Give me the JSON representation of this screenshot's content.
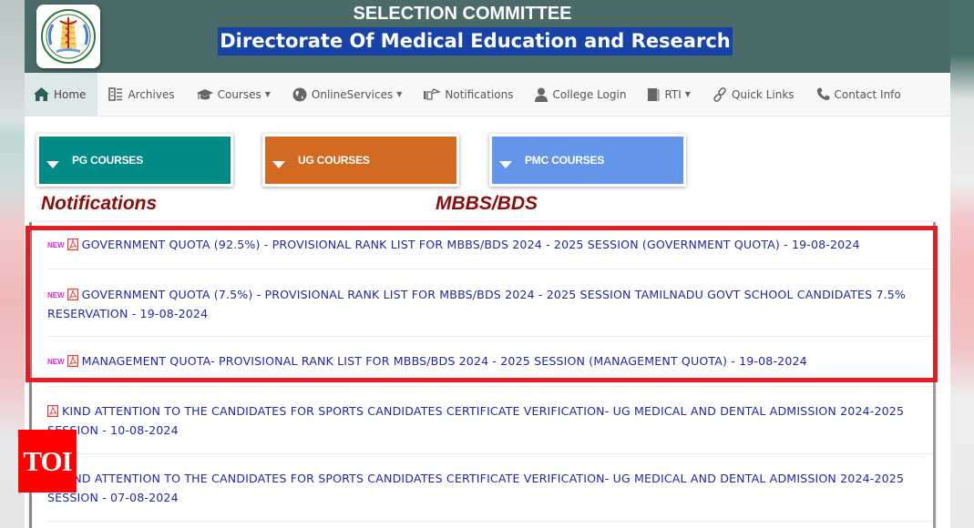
{
  "header": {
    "org_title": "SELECTION COMMITTEE",
    "main_title": "Directorate Of Medical Education and Research",
    "colors": {
      "header_bg": "#4a6b69",
      "title_highlight": "#1743a9"
    }
  },
  "nav": {
    "items": [
      {
        "label": "Home",
        "icon": "home-icon",
        "active": true,
        "dropdown": false
      },
      {
        "label": "Archives",
        "icon": "archive-icon",
        "active": false,
        "dropdown": false
      },
      {
        "label": "Courses",
        "icon": "graduation-cap-icon",
        "active": false,
        "dropdown": true
      },
      {
        "label": "OnlineServices",
        "icon": "globe-icon",
        "active": false,
        "dropdown": true
      },
      {
        "label": "Notifications",
        "icon": "hand-pointer-icon",
        "active": false,
        "dropdown": false
      },
      {
        "label": "College Login",
        "icon": "user-icon",
        "active": false,
        "dropdown": false
      },
      {
        "label": "RTI",
        "icon": "book-icon",
        "active": false,
        "dropdown": true
      },
      {
        "label": "Quick Links",
        "icon": "link-icon",
        "active": false,
        "dropdown": false
      },
      {
        "label": "Contact Info",
        "icon": "phone-icon",
        "active": false,
        "dropdown": false
      }
    ],
    "caret": "▼"
  },
  "courses": [
    {
      "label": "PG COURSES",
      "color": "#008b87"
    },
    {
      "label": "UG COURSES",
      "color": "#d36a22"
    },
    {
      "label": "PMC COURSES",
      "color": "#6495e8"
    }
  ],
  "sections": {
    "left_heading": "Notifications",
    "center_heading": "MBBS/BDS"
  },
  "notifications": [
    {
      "is_new": true,
      "new_label": "NEW",
      "text": "GOVERNMENT QUOTA (92.5%) - PROVISIONAL RANK LIST FOR MBBS/BDS 2024 - 2025 SESSION (GOVERNMENT QUOTA) - 19-08-2024",
      "highlighted": true
    },
    {
      "is_new": true,
      "new_label": "NEW",
      "text": "GOVERNMENT QUOTA (7.5%) - PROVISIONAL RANK LIST FOR MBBS/BDS 2024 - 2025 SESSION TAMILNADU GOVT SCHOOL CANDIDATES 7.5% RESERVATION - 19-08-2024",
      "highlighted": true
    },
    {
      "is_new": true,
      "new_label": "NEW",
      "text": "MANAGEMENT QUOTA- PROVISIONAL RANK LIST FOR MBBS/BDS 2024 - 2025 SESSION (MANAGEMENT QUOTA) - 19-08-2024",
      "highlighted": true
    },
    {
      "is_new": false,
      "new_label": "",
      "text": "KIND ATTENTION TO THE CANDIDATES FOR SPORTS CANDIDATES CERTIFICATE VERIFICATION- UG MEDICAL AND DENTAL ADMISSION 2024-2025 SESSION - 10-08-2024",
      "highlighted": false
    },
    {
      "is_new": false,
      "new_label": "",
      "text": "KIND ATTENTION TO THE CANDIDATES FOR SPORTS CANDIDATES CERTIFICATE VERIFICATION- UG MEDICAL AND DENTAL ADMISSION 2024-2025 SESSION - 07-08-2024",
      "highlighted": false
    }
  ],
  "watermark": {
    "label": "TOI",
    "color": "#ff0000"
  }
}
